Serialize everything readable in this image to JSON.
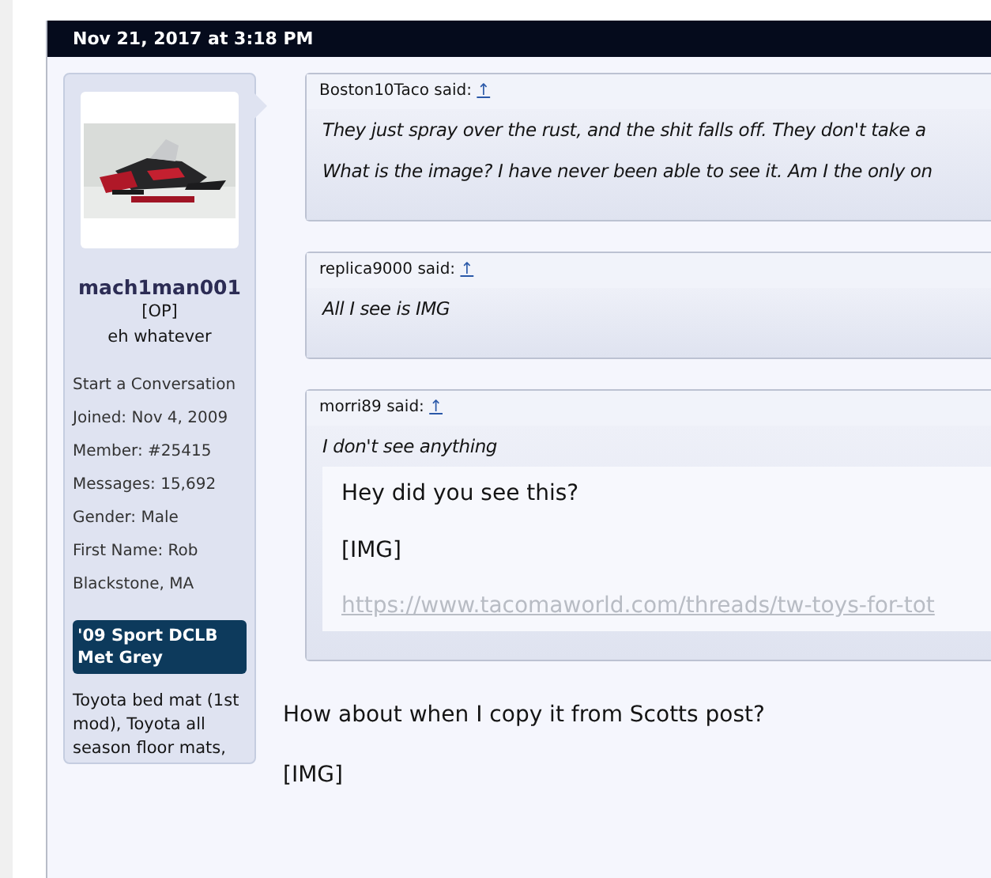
{
  "post": {
    "date": "Nov 21, 2017 at 3:18 PM"
  },
  "author": {
    "username": "mach1man001",
    "tag": "[OP]",
    "title": "eh whatever",
    "start_conversation": "Start a Conversation",
    "details": [
      {
        "label": "Joined:",
        "value": "Nov 4, 2009"
      },
      {
        "label": "Member:",
        "value": "#25415"
      },
      {
        "label": "Messages:",
        "value": "15,692"
      },
      {
        "label": "Gender:",
        "value": "Male"
      },
      {
        "label": "First Name:",
        "value": "Rob"
      }
    ],
    "location": "Blackstone, MA",
    "badge": "'09 Sport DCLB Met Grey",
    "signature": "Toyota bed mat (1st mod), Toyota all season floor mats,"
  },
  "quotes": [
    {
      "attribution": "Boston10Taco said:",
      "link": "↑",
      "paragraphs": [
        "They just spray over the rust, and the shit falls off. They don't take a",
        "What is the image? I have never been able to see it. Am I the only on"
      ]
    },
    {
      "attribution": "replica9000 said:",
      "link": "↑",
      "paragraphs": [
        "All I see is IMG"
      ]
    },
    {
      "attribution": "morri89 said:",
      "link": "↑",
      "paragraphs": [
        "I don't see anything"
      ],
      "nested": {
        "lines": [
          "Hey did you see this?",
          "[IMG]"
        ],
        "url": "https://www.tacomaworld.com/threads/tw-toys-for-tot"
      }
    }
  ],
  "message": [
    "How about when I copy it from Scotts post?",
    "[IMG]"
  ]
}
